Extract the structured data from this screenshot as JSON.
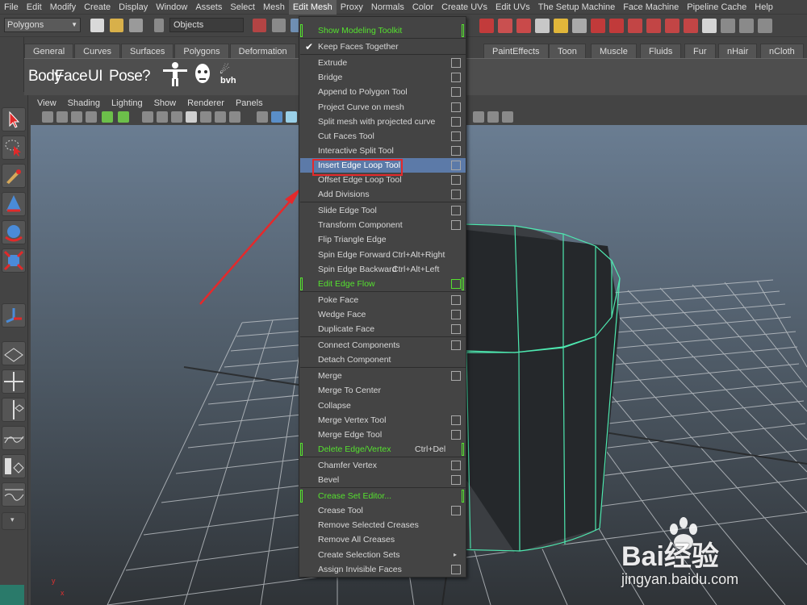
{
  "menubar": [
    "File",
    "Edit",
    "Modify",
    "Create",
    "Display",
    "Window",
    "Assets",
    "Select",
    "Mesh",
    "Edit Mesh",
    "Proxy",
    "Normals",
    "Color",
    "Create UVs",
    "Edit UVs",
    "The Setup Machine",
    "Face Machine",
    "Pipeline Cache",
    "Help"
  ],
  "statusline": {
    "mode_value": "Polygons",
    "objects_label": "Objects"
  },
  "shelf": {
    "tabs_left": [
      "General",
      "Curves",
      "Surfaces",
      "Polygons",
      "Deformation"
    ],
    "tabs_right": [
      "PaintEffects",
      "Toon",
      "Muscle",
      "Fluids",
      "Fur",
      "nHair",
      "nCloth"
    ],
    "items": [
      "Body",
      "Face",
      "UI",
      "Pose",
      "?"
    ],
    "bvh_label": "bvh"
  },
  "viewport_menu": [
    "View",
    "Shading",
    "Lighting",
    "Show",
    "Renderer",
    "Panels"
  ],
  "edit_mesh_menu": {
    "title": "Edit Mesh",
    "items": [
      {
        "label": "Show Modeling Toolkit",
        "style": "green"
      },
      {
        "label": "Keep Faces Together",
        "checked": true
      },
      {
        "label": "Extrude",
        "box": true
      },
      {
        "label": "Bridge",
        "box": true
      },
      {
        "label": "Append to Polygon Tool",
        "box": true
      },
      {
        "label": "Project Curve on mesh",
        "box": true
      },
      {
        "label": "Split mesh with projected curve",
        "box": true
      },
      {
        "label": "Cut Faces Tool",
        "box": true
      },
      {
        "label": "Interactive Split Tool",
        "box": true
      },
      {
        "label": "Insert Edge Loop Tool",
        "box": true,
        "highlighted": true
      },
      {
        "label": "Offset Edge Loop Tool",
        "box": true
      },
      {
        "label": "Add Divisions",
        "box": true
      },
      {
        "label": "Slide Edge Tool",
        "box": true
      },
      {
        "label": "Transform Component",
        "box": true
      },
      {
        "label": "Flip Triangle Edge"
      },
      {
        "label": "Spin Edge Forward",
        "shortcut": "Ctrl+Alt+Right"
      },
      {
        "label": "Spin Edge Backward",
        "shortcut": "Ctrl+Alt+Left"
      },
      {
        "label": "Edit Edge Flow",
        "style": "green",
        "box": true
      },
      {
        "label": "Poke Face",
        "box": true
      },
      {
        "label": "Wedge Face",
        "box": true
      },
      {
        "label": "Duplicate Face",
        "box": true
      },
      {
        "label": "Connect Components",
        "box": true
      },
      {
        "label": "Detach Component"
      },
      {
        "label": "Merge",
        "box": true
      },
      {
        "label": "Merge To Center"
      },
      {
        "label": "Collapse"
      },
      {
        "label": "Merge Vertex Tool",
        "box": true
      },
      {
        "label": "Merge Edge Tool",
        "box": true
      },
      {
        "label": "Delete Edge/Vertex",
        "style": "green",
        "shortcut": "Ctrl+Del"
      },
      {
        "label": "Chamfer Vertex",
        "box": true
      },
      {
        "label": "Bevel",
        "box": true
      },
      {
        "label": "Crease Set Editor...",
        "style": "green"
      },
      {
        "label": "Crease Tool",
        "box": true
      },
      {
        "label": "Remove Selected Creases"
      },
      {
        "label": "Remove All Creases"
      },
      {
        "label": "Create Selection Sets",
        "submenu": true
      },
      {
        "label": "Assign Invisible Faces",
        "box": true
      }
    ]
  },
  "watermark": {
    "brand": "Bai经验",
    "url": "jingyan.baidu.com"
  },
  "colors": {
    "highlight": "#5c7aa8",
    "green_item": "#55e12f",
    "annotation_red": "#e5292b",
    "mesh_wire": "#4ee8b0"
  }
}
